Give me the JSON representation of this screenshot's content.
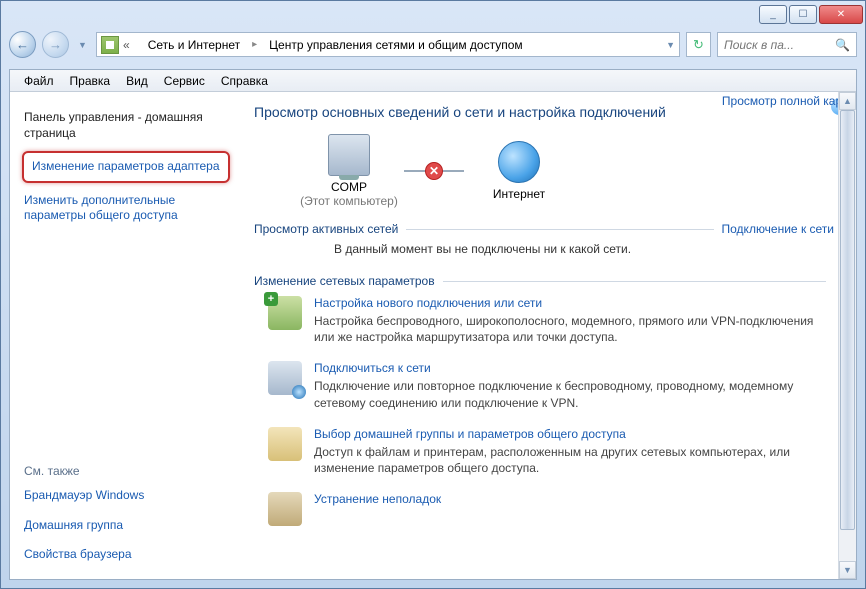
{
  "window": {
    "min_label": "_",
    "max_label": "☐",
    "close_label": "✕"
  },
  "nav": {
    "back": "←",
    "forward": "→",
    "chev": "▼",
    "refresh": "↻",
    "dropdown": "▼"
  },
  "address": {
    "double_chevron": "«",
    "seg1": "Сеть и Интернет",
    "arrow": "▸",
    "seg2": "Центр управления сетями и общим доступом"
  },
  "search": {
    "placeholder": "Поиск в па...",
    "icon": "🔍"
  },
  "menu": {
    "file": "Файл",
    "edit": "Правка",
    "view": "Вид",
    "service": "Сервис",
    "help": "Справка"
  },
  "help_icon": "?",
  "sidebar": {
    "home": "Панель управления - домашняя страница",
    "adapter": "Изменение параметров адаптера",
    "share": "Изменить дополнительные параметры общего доступа",
    "see_also": "См. также",
    "fw": "Брандмауэр Windows",
    "hg": "Домашняя группа",
    "bprops": "Свойства браузера"
  },
  "main": {
    "title": "Просмотр основных сведений о сети и настройка подключений",
    "map_link": "Просмотр полной карты",
    "comp": "COMP",
    "comp_sub": "(Этот компьютер)",
    "internet": "Интернет",
    "conn_x": "✕",
    "active_title": "Просмотр активных сетей",
    "connect_link": "Подключение к сети",
    "no_conn": "В данный момент вы не подключены ни к какой сети.",
    "change_title": "Изменение сетевых параметров",
    "tasks": [
      {
        "title": "Настройка нового подключения или сети",
        "desc": "Настройка беспроводного, широкополосного, модемного, прямого или VPN-подключения или же настройка маршрутизатора или точки доступа."
      },
      {
        "title": "Подключиться к сети",
        "desc": "Подключение или повторное подключение к беспроводному, проводному, модемному сетевому соединению или подключение к VPN."
      },
      {
        "title": "Выбор домашней группы и параметров общего доступа",
        "desc": "Доступ к файлам и принтерам, расположенным на других сетевых компьютерах, или изменение параметров общего доступа."
      },
      {
        "title": "Устранение неполадок",
        "desc": ""
      }
    ]
  }
}
